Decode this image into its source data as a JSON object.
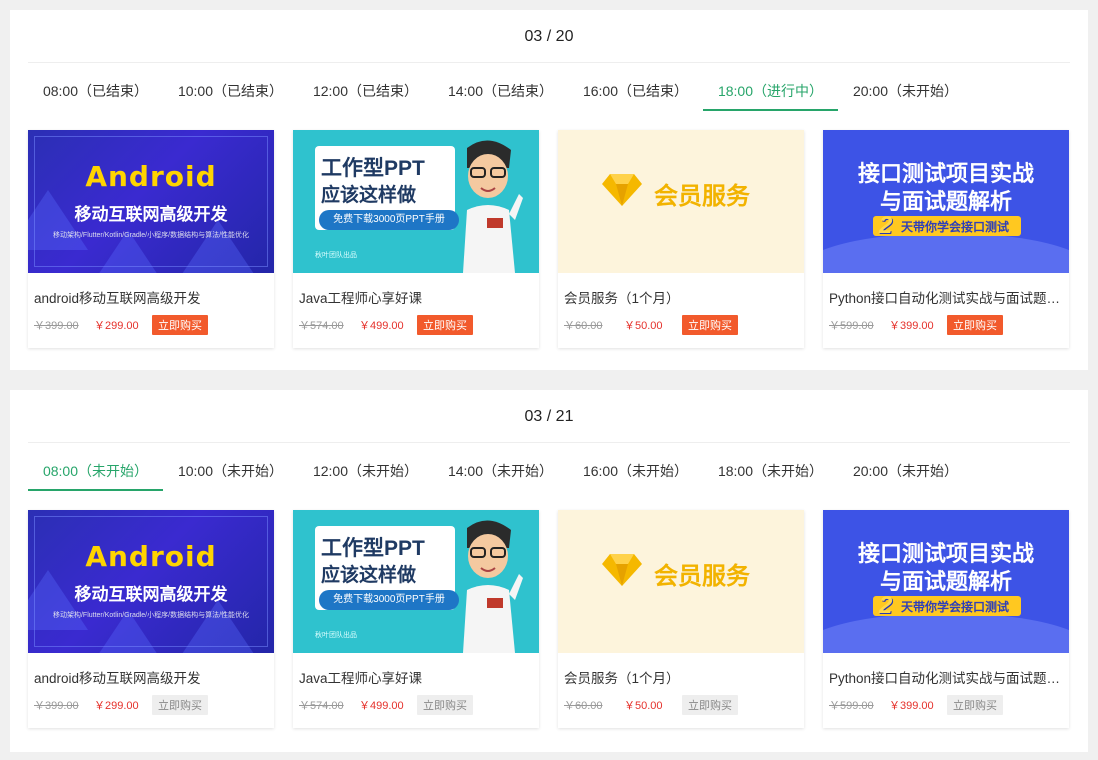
{
  "sessions": [
    {
      "date": "03 / 20",
      "tabs": [
        {
          "label": "08:00（已结束）",
          "active": false
        },
        {
          "label": "10:00（已结束）",
          "active": false
        },
        {
          "label": "12:00（已结束）",
          "active": false
        },
        {
          "label": "14:00（已结束）",
          "active": false
        },
        {
          "label": "16:00（已结束）",
          "active": false
        },
        {
          "label": "18:00（进行中）",
          "active": true
        },
        {
          "label": "20:00（未开始）",
          "active": false
        }
      ],
      "buy_state": "active"
    },
    {
      "date": "03 / 21",
      "tabs": [
        {
          "label": "08:00（未开始）",
          "active": true
        },
        {
          "label": "10:00（未开始）",
          "active": false
        },
        {
          "label": "12:00（未开始）",
          "active": false
        },
        {
          "label": "14:00（未开始）",
          "active": false
        },
        {
          "label": "16:00（未开始）",
          "active": false
        },
        {
          "label": "18:00（未开始）",
          "active": false
        },
        {
          "label": "20:00（未开始）",
          "active": false
        }
      ],
      "buy_state": "disabled"
    }
  ],
  "products": [
    {
      "title": "android移动互联网高级开发",
      "old_price": "￥399.00",
      "new_price": "￥299.00",
      "buy_label": "立即购买",
      "banner": {
        "h1": "Android",
        "h2": "移动互联网高级开发",
        "h3": "移动架构/Flutter/Kotlin/Gradle/小程序/数据结构与算法/性能优化"
      }
    },
    {
      "title": "Java工程师心享好课",
      "old_price": "￥574.00",
      "new_price": "￥499.00",
      "buy_label": "立即购买",
      "banner": {
        "l1": "工作型PPT",
        "l2": "应该这样做",
        "pill": "免费下载3000页PPT手册",
        "foot": "秋叶团队出品"
      }
    },
    {
      "title": "会员服务（1个月）",
      "old_price": "￥60.00",
      "new_price": "￥50.00",
      "buy_label": "立即购买",
      "banner": {
        "txt": "会员服务"
      }
    },
    {
      "title": "Python接口自动化测试实战与面试题解析",
      "old_price": "￥599.00",
      "new_price": "￥399.00",
      "buy_label": "立即购买",
      "banner": {
        "l1": "接口测试项目实战",
        "l2": "与面试题解析",
        "num": "2",
        "sub": "天带你学会接口测试"
      }
    }
  ],
  "colors": {
    "accent": "#27a56a",
    "price": "#e5312b",
    "buy": "#f25a2c"
  }
}
